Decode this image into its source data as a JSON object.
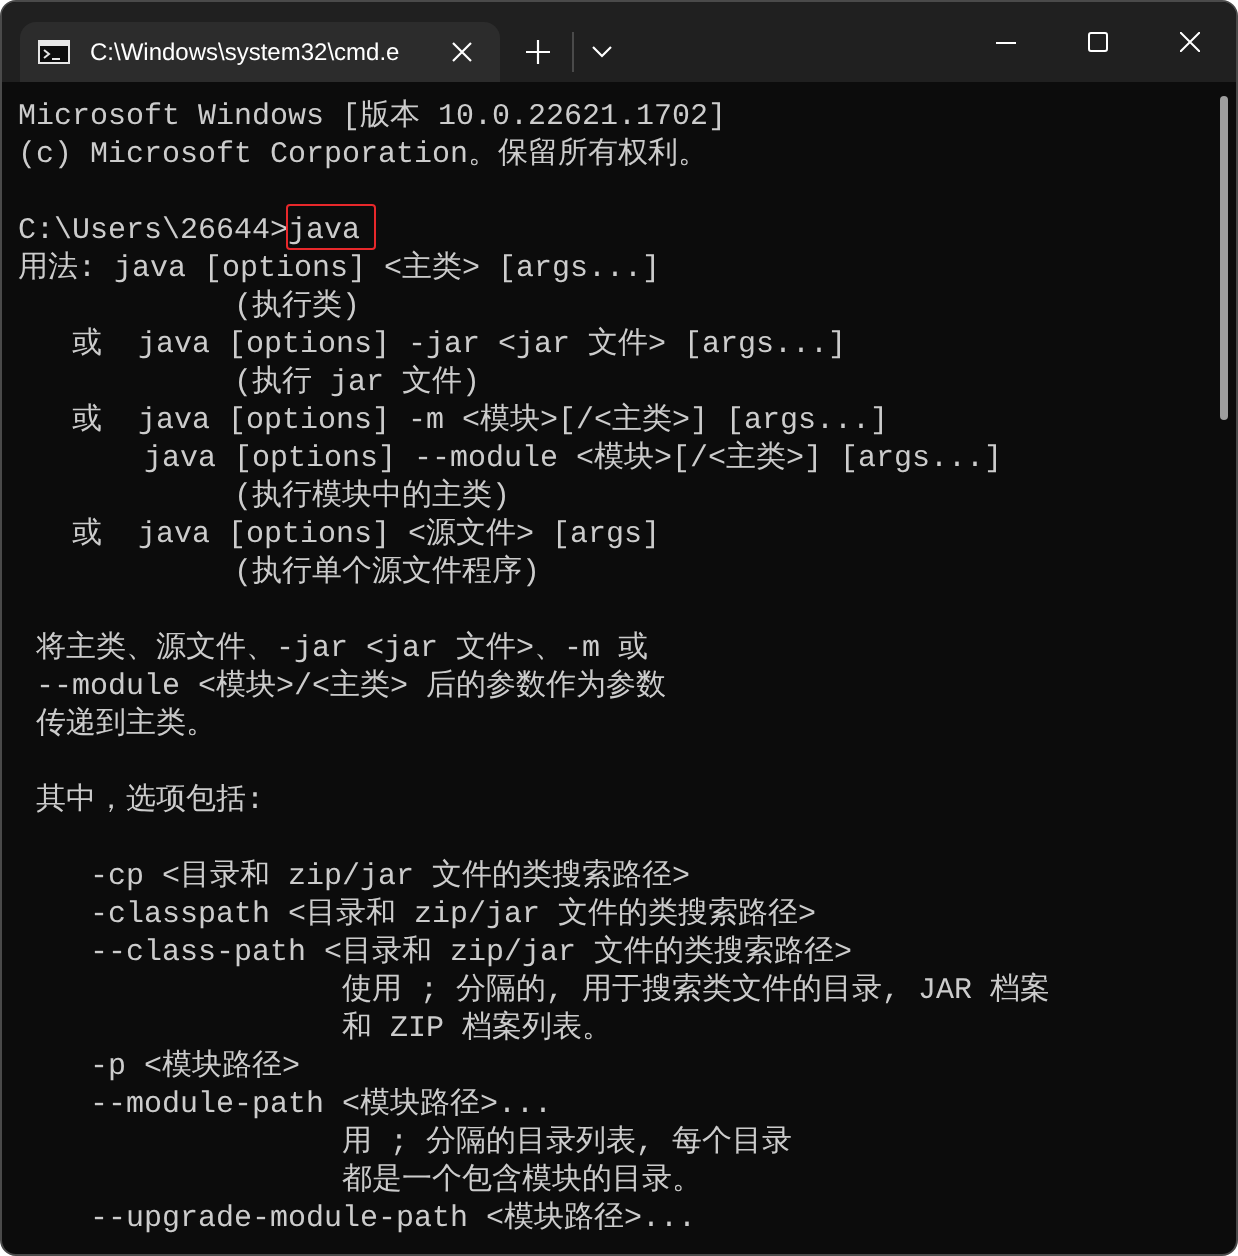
{
  "tabs": [
    {
      "title": "C:\\Windows\\system32\\cmd.e",
      "selected": true
    }
  ],
  "console": {
    "blocks": [
      [
        {
          "kind": "output",
          "text": "Microsoft Windows [版本 10.0.22621.1702]"
        },
        {
          "kind": "output",
          "text": "(c) Microsoft Corporation。保留所有权利。"
        }
      ],
      [
        {
          "kind": "prompt",
          "prompt": "C:\\Users\\26644>",
          "command": "java",
          "highlighted": true
        },
        {
          "kind": "output",
          "text": "用法: java [options] <主类> [args...]"
        },
        {
          "kind": "output",
          "text": "            (执行类)"
        },
        {
          "kind": "output",
          "text": "   或  java [options] -jar <jar 文件> [args...]"
        },
        {
          "kind": "output",
          "text": "            (执行 jar 文件)"
        },
        {
          "kind": "output",
          "text": "   或  java [options] -m <模块>[/<主类>] [args...]"
        },
        {
          "kind": "output",
          "text": "       java [options] --module <模块>[/<主类>] [args...]"
        },
        {
          "kind": "output",
          "text": "            (执行模块中的主类)"
        },
        {
          "kind": "output",
          "text": "   或  java [options] <源文件> [args]"
        },
        {
          "kind": "output",
          "text": "            (执行单个源文件程序)"
        }
      ],
      [
        {
          "kind": "output",
          "text": " 将主类、源文件、-jar <jar 文件>、-m 或"
        },
        {
          "kind": "output",
          "text": " --module <模块>/<主类> 后的参数作为参数"
        },
        {
          "kind": "output",
          "text": " 传递到主类。"
        }
      ],
      [
        {
          "kind": "output",
          "text": " 其中，选项包括:"
        }
      ],
      [
        {
          "kind": "output",
          "text": "    -cp <目录和 zip/jar 文件的类搜索路径>"
        },
        {
          "kind": "output",
          "text": "    -classpath <目录和 zip/jar 文件的类搜索路径>"
        },
        {
          "kind": "output",
          "text": "    --class-path <目录和 zip/jar 文件的类搜索路径>"
        },
        {
          "kind": "output",
          "text": "                  使用 ; 分隔的, 用于搜索类文件的目录, JAR 档案"
        },
        {
          "kind": "output",
          "text": "                  和 ZIP 档案列表。"
        },
        {
          "kind": "output",
          "text": "    -p <模块路径>"
        },
        {
          "kind": "output",
          "text": "    --module-path <模块路径>..."
        },
        {
          "kind": "output",
          "text": "                  用 ; 分隔的目录列表, 每个目录"
        },
        {
          "kind": "output",
          "text": "                  都是一个包含模块的目录。"
        },
        {
          "kind": "output",
          "text": "    --upgrade-module-path <模块路径>..."
        }
      ]
    ]
  }
}
